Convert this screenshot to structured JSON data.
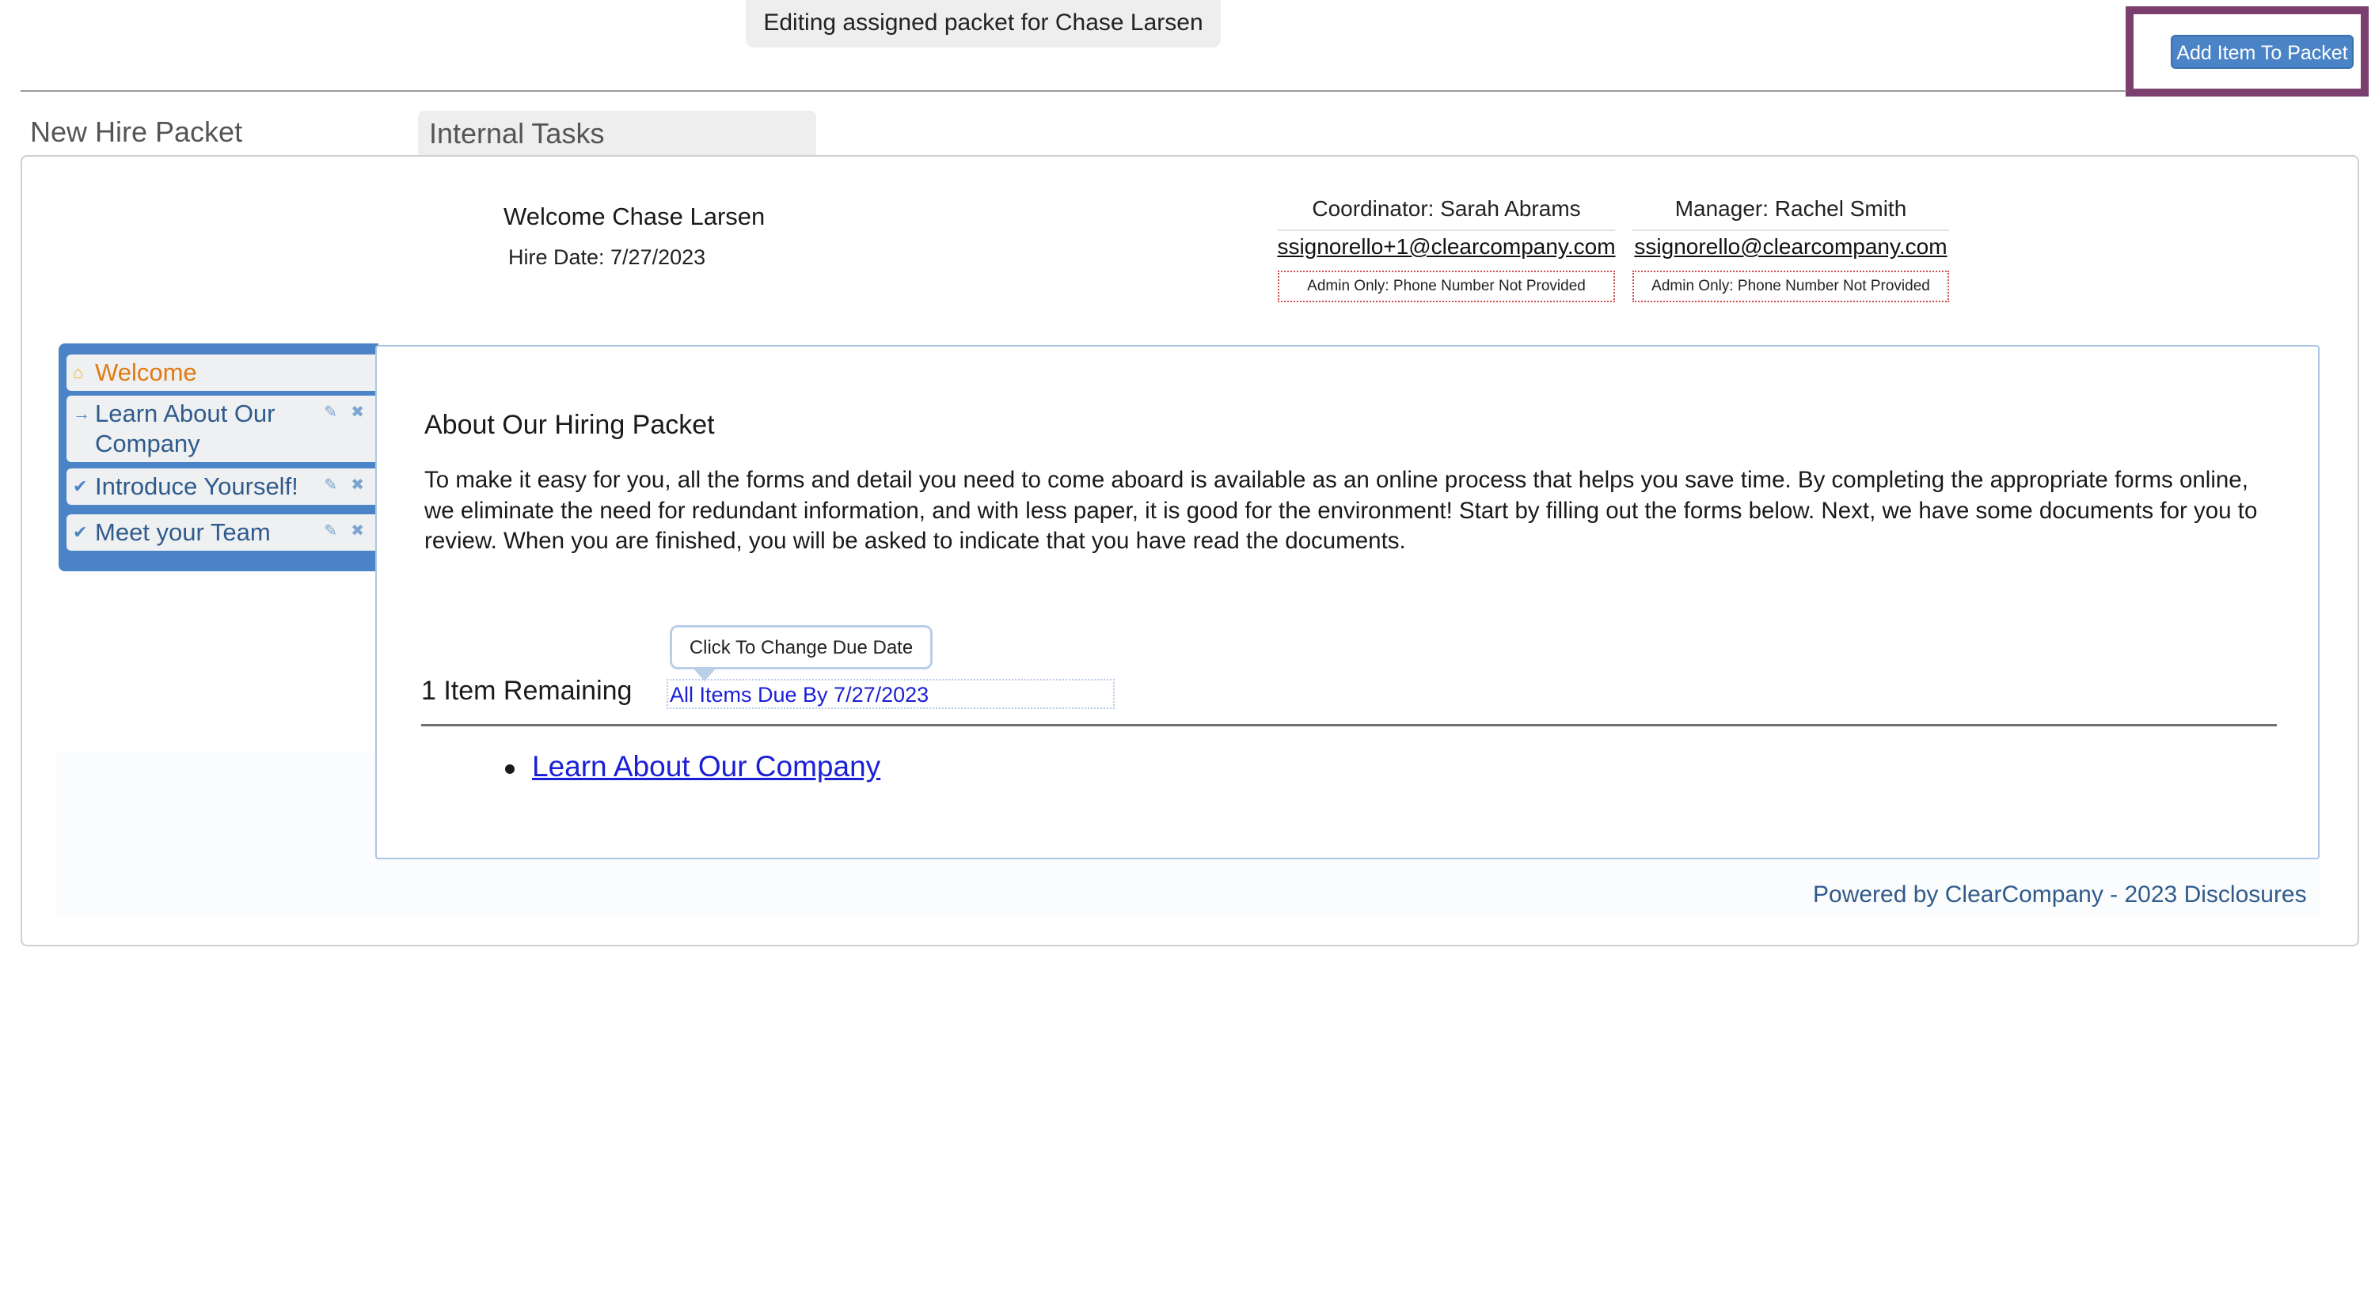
{
  "banner": {
    "text": "Editing assigned packet for Chase Larsen"
  },
  "toolbar": {
    "add_item_label": "Add Item To Packet"
  },
  "tabs": [
    {
      "label": "New Hire Packet"
    },
    {
      "label": "Internal Tasks"
    }
  ],
  "header": {
    "welcome": "Welcome Chase Larsen",
    "hire_date": "Hire Date: 7/27/2023",
    "coordinator": {
      "name": "Coordinator: Sarah Abrams",
      "email": "ssignorello+1@clearcompany.com",
      "phone": "Admin Only: Phone Number Not Provided"
    },
    "manager": {
      "name": "Manager: Rachel Smith",
      "email": "ssignorello@clearcompany.com",
      "phone": "Admin Only: Phone Number Not Provided"
    }
  },
  "sidebar": {
    "items": [
      {
        "label": "Welcome",
        "icon": "home-icon",
        "state": "active"
      },
      {
        "label": "Learn About Our Company",
        "icon": "arrow-right-icon",
        "state": "pending"
      },
      {
        "label": "Introduce Yourself!",
        "icon": "check-icon",
        "state": "done"
      },
      {
        "label": "Meet your Team",
        "icon": "check-icon",
        "state": "done"
      }
    ]
  },
  "main": {
    "heading": "About Our Hiring Packet",
    "body": "To make it easy for you, all the forms and detail you need to come aboard is available as an online process that helps you save time. By completing the appropriate forms online, we eliminate the need for redundant information, and with less paper, it is good for the environment! Start by filling out the forms below. Next, we have some documents for you to review. When you are finished, you will be asked to indicate that you have read the documents.",
    "tooltip": "Click To Change Due Date",
    "remaining": "1 Item Remaining",
    "due_date": "All Items Due By  7/27/2023",
    "items": [
      {
        "label": "Learn About Our Company"
      }
    ]
  },
  "footer": {
    "text": "Powered by ClearCompany - 2023 Disclosures"
  },
  "colors": {
    "accent": "#4b84c6",
    "highlight_frame": "#7a3f6e",
    "link": "#1a1fd6",
    "active_item": "#e07b10",
    "sidebar_text": "#2f5b8c"
  }
}
